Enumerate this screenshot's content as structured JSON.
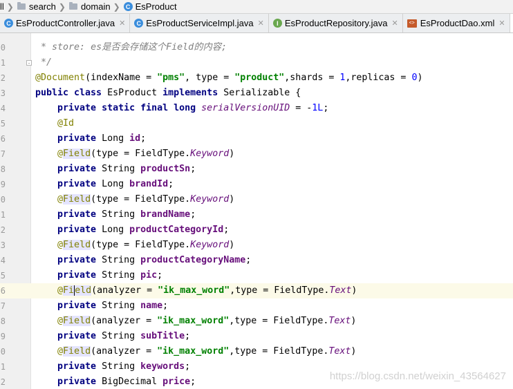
{
  "breadcrumb": {
    "items": [
      {
        "label": "ll",
        "icon": "none"
      },
      {
        "label": "search",
        "icon": "folder-icon"
      },
      {
        "label": "domain",
        "icon": "folder-icon"
      },
      {
        "label": "EsProduct",
        "icon": "class-icon"
      }
    ]
  },
  "tabs": [
    {
      "label": "EsProductController.java",
      "icon": "class-icon",
      "active": false
    },
    {
      "label": "EsProductServiceImpl.java",
      "icon": "class-icon",
      "active": false
    },
    {
      "label": "EsProductRepository.java",
      "icon": "interface-icon",
      "active": false
    },
    {
      "label": "EsProductDao.xml",
      "icon": "xml-icon",
      "active": false
    },
    {
      "label": "",
      "icon": "class-icon",
      "active": true
    }
  ],
  "icons": {
    "class_letter": "C",
    "interface_letter": "I",
    "xml_letter": "<>"
  },
  "editor": {
    "lines": [
      {
        "num": "0",
        "tokens": [
          {
            "t": " * store: ",
            "c": "comment"
          },
          {
            "t": "es",
            "c": "comment"
          },
          {
            "t": "是否会存储这个",
            "c": "comment"
          },
          {
            "t": "Field",
            "c": "comment"
          },
          {
            "t": "的内容;",
            "c": "comment"
          }
        ]
      },
      {
        "num": "1",
        "tokens": [
          {
            "t": " */",
            "c": "comment"
          }
        ]
      },
      {
        "num": "2",
        "tokens": [
          {
            "t": "@Document",
            "c": "ann"
          },
          {
            "t": "(indexName = ",
            "c": ""
          },
          {
            "t": "\"pms\"",
            "c": "str"
          },
          {
            "t": ", type = ",
            "c": ""
          },
          {
            "t": "\"product\"",
            "c": "str"
          },
          {
            "t": ",shards = ",
            "c": ""
          },
          {
            "t": "1",
            "c": "num"
          },
          {
            "t": ",replicas = ",
            "c": ""
          },
          {
            "t": "0",
            "c": "num"
          },
          {
            "t": ")",
            "c": ""
          }
        ]
      },
      {
        "num": "3",
        "tokens": [
          {
            "t": "public class ",
            "c": "kw"
          },
          {
            "t": "EsProduct ",
            "c": ""
          },
          {
            "t": "implements ",
            "c": "kw"
          },
          {
            "t": "Serializable {",
            "c": ""
          }
        ]
      },
      {
        "num": "4",
        "tokens": [
          {
            "t": "    private static final long ",
            "c": "kw"
          },
          {
            "t": "serialVersionUID",
            "c": "static-field"
          },
          {
            "t": " = -",
            "c": ""
          },
          {
            "t": "1L",
            "c": "num"
          },
          {
            "t": ";",
            "c": ""
          }
        ]
      },
      {
        "num": "5",
        "tokens": [
          {
            "t": "    ",
            "c": ""
          },
          {
            "t": "@Id",
            "c": "ann"
          }
        ]
      },
      {
        "num": "6",
        "tokens": [
          {
            "t": "    private ",
            "c": "kw"
          },
          {
            "t": "Long ",
            "c": ""
          },
          {
            "t": "id",
            "c": "field"
          },
          {
            "t": ";",
            "c": ""
          }
        ]
      },
      {
        "num": "7",
        "tokens": [
          {
            "t": "    ",
            "c": ""
          },
          {
            "t": "@",
            "c": "ann"
          },
          {
            "t": "Field",
            "c": "ann ann-hl"
          },
          {
            "t": "(type = FieldType.",
            "c": ""
          },
          {
            "t": "Keyword",
            "c": "enum"
          },
          {
            "t": ")",
            "c": ""
          }
        ]
      },
      {
        "num": "8",
        "tokens": [
          {
            "t": "    private ",
            "c": "kw"
          },
          {
            "t": "String ",
            "c": ""
          },
          {
            "t": "productSn",
            "c": "field"
          },
          {
            "t": ";",
            "c": ""
          }
        ]
      },
      {
        "num": "9",
        "tokens": [
          {
            "t": "    private ",
            "c": "kw"
          },
          {
            "t": "Long ",
            "c": ""
          },
          {
            "t": "brandId",
            "c": "field"
          },
          {
            "t": ";",
            "c": ""
          }
        ]
      },
      {
        "num": "0",
        "tokens": [
          {
            "t": "    ",
            "c": ""
          },
          {
            "t": "@",
            "c": "ann"
          },
          {
            "t": "Field",
            "c": "ann ann-hl"
          },
          {
            "t": "(type = FieldType.",
            "c": ""
          },
          {
            "t": "Keyword",
            "c": "enum"
          },
          {
            "t": ")",
            "c": ""
          }
        ]
      },
      {
        "num": "1",
        "tokens": [
          {
            "t": "    private ",
            "c": "kw"
          },
          {
            "t": "String ",
            "c": ""
          },
          {
            "t": "brandName",
            "c": "field"
          },
          {
            "t": ";",
            "c": ""
          }
        ]
      },
      {
        "num": "2",
        "tokens": [
          {
            "t": "    private ",
            "c": "kw"
          },
          {
            "t": "Long ",
            "c": ""
          },
          {
            "t": "productCategoryId",
            "c": "field"
          },
          {
            "t": ";",
            "c": ""
          }
        ]
      },
      {
        "num": "3",
        "tokens": [
          {
            "t": "    ",
            "c": ""
          },
          {
            "t": "@",
            "c": "ann"
          },
          {
            "t": "Field",
            "c": "ann ann-hl"
          },
          {
            "t": "(type = FieldType.",
            "c": ""
          },
          {
            "t": "Keyword",
            "c": "enum"
          },
          {
            "t": ")",
            "c": ""
          }
        ]
      },
      {
        "num": "4",
        "tokens": [
          {
            "t": "    private ",
            "c": "kw"
          },
          {
            "t": "String ",
            "c": ""
          },
          {
            "t": "productCategoryName",
            "c": "field"
          },
          {
            "t": ";",
            "c": ""
          }
        ]
      },
      {
        "num": "5",
        "tokens": [
          {
            "t": "    private ",
            "c": "kw"
          },
          {
            "t": "String ",
            "c": ""
          },
          {
            "t": "pic",
            "c": "field"
          },
          {
            "t": ";",
            "c": ""
          }
        ]
      },
      {
        "num": "6",
        "current": true,
        "tokens": [
          {
            "t": "    ",
            "c": ""
          },
          {
            "t": "@",
            "c": "ann"
          },
          {
            "t": "Fi",
            "c": "ann ann-hl"
          },
          {
            "t": "|",
            "c": "caret"
          },
          {
            "t": "eld",
            "c": "ann ann-hl"
          },
          {
            "t": "(analyzer = ",
            "c": ""
          },
          {
            "t": "\"ik_max_word\"",
            "c": "str"
          },
          {
            "t": ",type = FieldType.",
            "c": ""
          },
          {
            "t": "Text",
            "c": "enum"
          },
          {
            "t": ")",
            "c": ""
          }
        ]
      },
      {
        "num": "7",
        "tokens": [
          {
            "t": "    private ",
            "c": "kw"
          },
          {
            "t": "String ",
            "c": ""
          },
          {
            "t": "name",
            "c": "field"
          },
          {
            "t": ";",
            "c": ""
          }
        ]
      },
      {
        "num": "8",
        "tokens": [
          {
            "t": "    ",
            "c": ""
          },
          {
            "t": "@",
            "c": "ann"
          },
          {
            "t": "Field",
            "c": "ann ann-hl"
          },
          {
            "t": "(analyzer = ",
            "c": ""
          },
          {
            "t": "\"ik_max_word\"",
            "c": "str"
          },
          {
            "t": ",type = FieldType.",
            "c": ""
          },
          {
            "t": "Text",
            "c": "enum"
          },
          {
            "t": ")",
            "c": ""
          }
        ]
      },
      {
        "num": "9",
        "tokens": [
          {
            "t": "    private ",
            "c": "kw"
          },
          {
            "t": "String ",
            "c": ""
          },
          {
            "t": "subTitle",
            "c": "field"
          },
          {
            "t": ";",
            "c": ""
          }
        ]
      },
      {
        "num": "0",
        "tokens": [
          {
            "t": "    ",
            "c": ""
          },
          {
            "t": "@",
            "c": "ann"
          },
          {
            "t": "Field",
            "c": "ann ann-hl"
          },
          {
            "t": "(analyzer = ",
            "c": ""
          },
          {
            "t": "\"ik_max_word\"",
            "c": "str"
          },
          {
            "t": ",type = FieldType.",
            "c": ""
          },
          {
            "t": "Text",
            "c": "enum"
          },
          {
            "t": ")",
            "c": ""
          }
        ]
      },
      {
        "num": "1",
        "tokens": [
          {
            "t": "    private ",
            "c": "kw"
          },
          {
            "t": "String ",
            "c": ""
          },
          {
            "t": "keywords",
            "c": "field"
          },
          {
            "t": ";",
            "c": ""
          }
        ]
      },
      {
        "num": "2",
        "tokens": [
          {
            "t": "    private ",
            "c": "kw"
          },
          {
            "t": "BigDecimal ",
            "c": ""
          },
          {
            "t": "price",
            "c": "field"
          },
          {
            "t": ";",
            "c": ""
          }
        ]
      }
    ]
  },
  "watermark": "https://blog.csdn.net/weixin_43564627",
  "colors": {
    "keyword": "#000080",
    "annotation": "#808000",
    "string": "#008000",
    "number": "#0000ff",
    "field": "#660e7a",
    "comment": "#808080",
    "current_line": "#fcfae8"
  }
}
